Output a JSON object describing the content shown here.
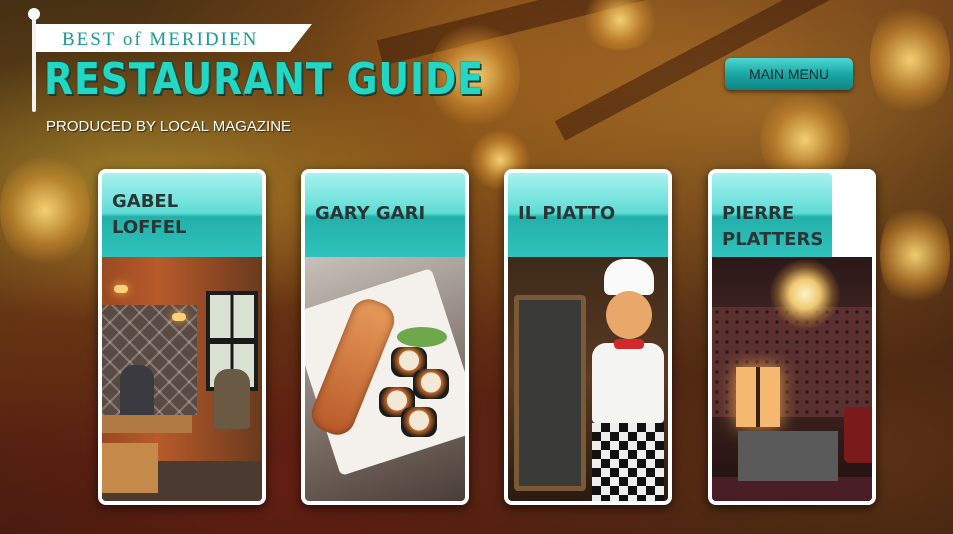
{
  "header": {
    "kicker": "BEST of MERIDIEN",
    "title": "RESTAURANT GUIDE",
    "subtitle": "PRODUCED BY LOCAL MAGAZINE"
  },
  "nav": {
    "main_menu_label": "MAIN MENU"
  },
  "restaurants": [
    {
      "name": "GABEL LOFFEL",
      "photo": "restaurant-interior"
    },
    {
      "name": "GARY GARI",
      "photo": "sushi-plate"
    },
    {
      "name": "IL PIATTO",
      "photo": "chef-statue-chalkboard"
    },
    {
      "name": "PIERRE PLATTERS",
      "photo": "chandelier-dining-room"
    }
  ],
  "colors": {
    "accent": "#21d8c4",
    "card_header": "#5fdcd6",
    "button": "#1aa7a4"
  }
}
